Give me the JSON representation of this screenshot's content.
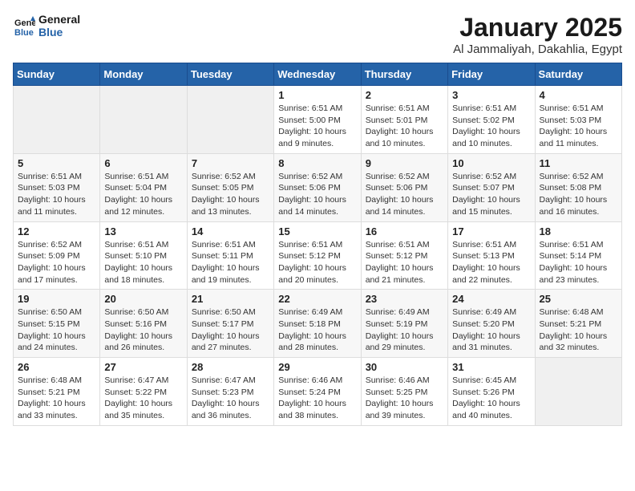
{
  "header": {
    "logo_line1": "General",
    "logo_line2": "Blue",
    "title": "January 2025",
    "subtitle": "Al Jammaliyah, Dakahlia, Egypt"
  },
  "weekdays": [
    "Sunday",
    "Monday",
    "Tuesday",
    "Wednesday",
    "Thursday",
    "Friday",
    "Saturday"
  ],
  "weeks": [
    [
      {
        "day": "",
        "info": ""
      },
      {
        "day": "",
        "info": ""
      },
      {
        "day": "",
        "info": ""
      },
      {
        "day": "1",
        "info": "Sunrise: 6:51 AM\nSunset: 5:00 PM\nDaylight: 10 hours\nand 9 minutes."
      },
      {
        "day": "2",
        "info": "Sunrise: 6:51 AM\nSunset: 5:01 PM\nDaylight: 10 hours\nand 10 minutes."
      },
      {
        "day": "3",
        "info": "Sunrise: 6:51 AM\nSunset: 5:02 PM\nDaylight: 10 hours\nand 10 minutes."
      },
      {
        "day": "4",
        "info": "Sunrise: 6:51 AM\nSunset: 5:03 PM\nDaylight: 10 hours\nand 11 minutes."
      }
    ],
    [
      {
        "day": "5",
        "info": "Sunrise: 6:51 AM\nSunset: 5:03 PM\nDaylight: 10 hours\nand 11 minutes."
      },
      {
        "day": "6",
        "info": "Sunrise: 6:51 AM\nSunset: 5:04 PM\nDaylight: 10 hours\nand 12 minutes."
      },
      {
        "day": "7",
        "info": "Sunrise: 6:52 AM\nSunset: 5:05 PM\nDaylight: 10 hours\nand 13 minutes."
      },
      {
        "day": "8",
        "info": "Sunrise: 6:52 AM\nSunset: 5:06 PM\nDaylight: 10 hours\nand 14 minutes."
      },
      {
        "day": "9",
        "info": "Sunrise: 6:52 AM\nSunset: 5:06 PM\nDaylight: 10 hours\nand 14 minutes."
      },
      {
        "day": "10",
        "info": "Sunrise: 6:52 AM\nSunset: 5:07 PM\nDaylight: 10 hours\nand 15 minutes."
      },
      {
        "day": "11",
        "info": "Sunrise: 6:52 AM\nSunset: 5:08 PM\nDaylight: 10 hours\nand 16 minutes."
      }
    ],
    [
      {
        "day": "12",
        "info": "Sunrise: 6:52 AM\nSunset: 5:09 PM\nDaylight: 10 hours\nand 17 minutes."
      },
      {
        "day": "13",
        "info": "Sunrise: 6:51 AM\nSunset: 5:10 PM\nDaylight: 10 hours\nand 18 minutes."
      },
      {
        "day": "14",
        "info": "Sunrise: 6:51 AM\nSunset: 5:11 PM\nDaylight: 10 hours\nand 19 minutes."
      },
      {
        "day": "15",
        "info": "Sunrise: 6:51 AM\nSunset: 5:12 PM\nDaylight: 10 hours\nand 20 minutes."
      },
      {
        "day": "16",
        "info": "Sunrise: 6:51 AM\nSunset: 5:12 PM\nDaylight: 10 hours\nand 21 minutes."
      },
      {
        "day": "17",
        "info": "Sunrise: 6:51 AM\nSunset: 5:13 PM\nDaylight: 10 hours\nand 22 minutes."
      },
      {
        "day": "18",
        "info": "Sunrise: 6:51 AM\nSunset: 5:14 PM\nDaylight: 10 hours\nand 23 minutes."
      }
    ],
    [
      {
        "day": "19",
        "info": "Sunrise: 6:50 AM\nSunset: 5:15 PM\nDaylight: 10 hours\nand 24 minutes."
      },
      {
        "day": "20",
        "info": "Sunrise: 6:50 AM\nSunset: 5:16 PM\nDaylight: 10 hours\nand 26 minutes."
      },
      {
        "day": "21",
        "info": "Sunrise: 6:50 AM\nSunset: 5:17 PM\nDaylight: 10 hours\nand 27 minutes."
      },
      {
        "day": "22",
        "info": "Sunrise: 6:49 AM\nSunset: 5:18 PM\nDaylight: 10 hours\nand 28 minutes."
      },
      {
        "day": "23",
        "info": "Sunrise: 6:49 AM\nSunset: 5:19 PM\nDaylight: 10 hours\nand 29 minutes."
      },
      {
        "day": "24",
        "info": "Sunrise: 6:49 AM\nSunset: 5:20 PM\nDaylight: 10 hours\nand 31 minutes."
      },
      {
        "day": "25",
        "info": "Sunrise: 6:48 AM\nSunset: 5:21 PM\nDaylight: 10 hours\nand 32 minutes."
      }
    ],
    [
      {
        "day": "26",
        "info": "Sunrise: 6:48 AM\nSunset: 5:21 PM\nDaylight: 10 hours\nand 33 minutes."
      },
      {
        "day": "27",
        "info": "Sunrise: 6:47 AM\nSunset: 5:22 PM\nDaylight: 10 hours\nand 35 minutes."
      },
      {
        "day": "28",
        "info": "Sunrise: 6:47 AM\nSunset: 5:23 PM\nDaylight: 10 hours\nand 36 minutes."
      },
      {
        "day": "29",
        "info": "Sunrise: 6:46 AM\nSunset: 5:24 PM\nDaylight: 10 hours\nand 38 minutes."
      },
      {
        "day": "30",
        "info": "Sunrise: 6:46 AM\nSunset: 5:25 PM\nDaylight: 10 hours\nand 39 minutes."
      },
      {
        "day": "31",
        "info": "Sunrise: 6:45 AM\nSunset: 5:26 PM\nDaylight: 10 hours\nand 40 minutes."
      },
      {
        "day": "",
        "info": ""
      }
    ]
  ]
}
